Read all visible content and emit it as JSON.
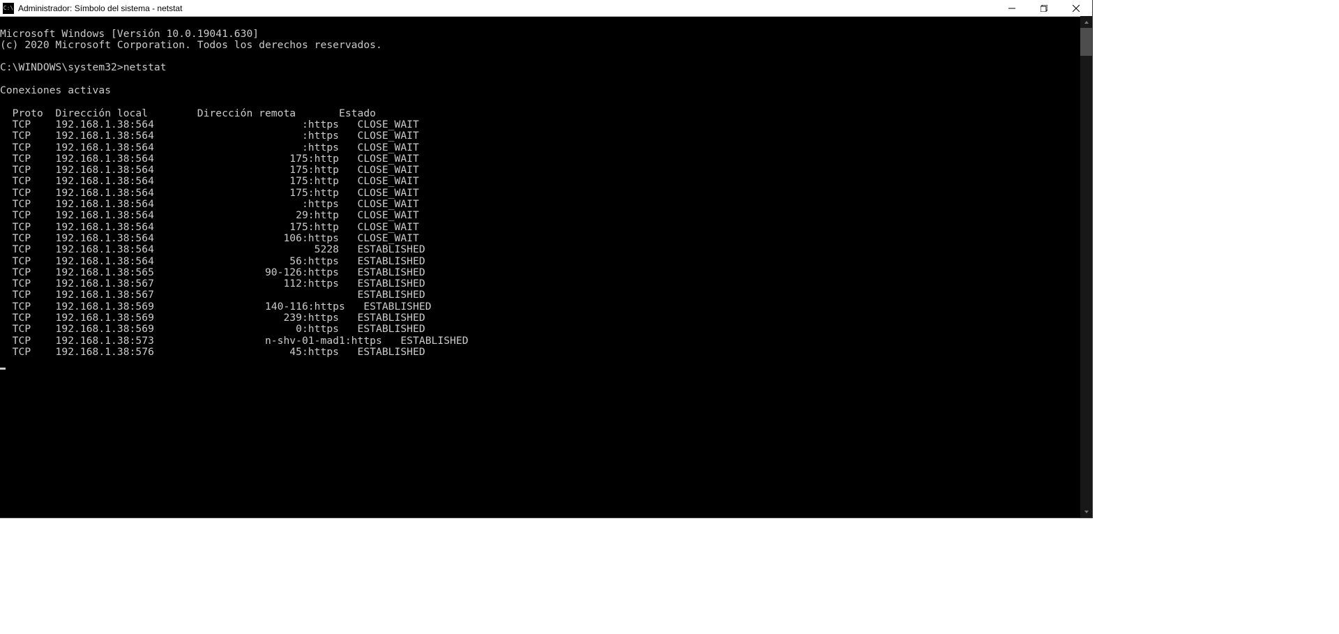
{
  "titlebar": {
    "icon_text": "C:\\",
    "title": "Administrador: Símbolo del sistema - netstat"
  },
  "terminal": {
    "line_version": "Microsoft Windows [Versión 10.0.19041.630]",
    "line_copyright": "(c) 2020 Microsoft Corporation. Todos los derechos reservados.",
    "prompt": "C:\\WINDOWS\\system32>",
    "command": "netstat",
    "section_title": "Conexiones activas",
    "headers": {
      "proto": "Proto",
      "local": "Dirección local",
      "remote": "Dirección remota",
      "state": "Estado"
    },
    "rows": [
      {
        "proto": "TCP",
        "local": "192.168.1.38:564",
        "remote": ":https",
        "state": "CLOSE_WAIT"
      },
      {
        "proto": "TCP",
        "local": "192.168.1.38:564",
        "remote": ":https",
        "state": "CLOSE_WAIT"
      },
      {
        "proto": "TCP",
        "local": "192.168.1.38:564",
        "remote": ":https",
        "state": "CLOSE_WAIT"
      },
      {
        "proto": "TCP",
        "local": "192.168.1.38:564",
        "remote": "175:http",
        "state": "CLOSE_WAIT"
      },
      {
        "proto": "TCP",
        "local": "192.168.1.38:564",
        "remote": "175:http",
        "state": "CLOSE_WAIT"
      },
      {
        "proto": "TCP",
        "local": "192.168.1.38:564",
        "remote": "175:http",
        "state": "CLOSE_WAIT"
      },
      {
        "proto": "TCP",
        "local": "192.168.1.38:564",
        "remote": "175:http",
        "state": "CLOSE_WAIT"
      },
      {
        "proto": "TCP",
        "local": "192.168.1.38:564",
        "remote": ":https",
        "state": "CLOSE_WAIT"
      },
      {
        "proto": "TCP",
        "local": "192.168.1.38:564",
        "remote": "29:http",
        "state": "CLOSE_WAIT"
      },
      {
        "proto": "TCP",
        "local": "192.168.1.38:564",
        "remote": "175:http",
        "state": "CLOSE_WAIT"
      },
      {
        "proto": "TCP",
        "local": "192.168.1.38:564",
        "remote": "106:https",
        "state": "CLOSE_WAIT"
      },
      {
        "proto": "TCP",
        "local": "192.168.1.38:564",
        "remote": "5228",
        "state": "ESTABLISHED"
      },
      {
        "proto": "TCP",
        "local": "192.168.1.38:564",
        "remote": "56:https",
        "state": "ESTABLISHED"
      },
      {
        "proto": "TCP",
        "local": "192.168.1.38:565",
        "remote": "90-126:https",
        "state": "ESTABLISHED"
      },
      {
        "proto": "TCP",
        "local": "192.168.1.38:567",
        "remote": "112:https",
        "state": "ESTABLISHED"
      },
      {
        "proto": "TCP",
        "local": "192.168.1.38:567",
        "remote": "",
        "state": "ESTABLISHED"
      },
      {
        "proto": "TCP",
        "local": "192.168.1.38:569",
        "remote": "140-116:https",
        "state": "ESTABLISHED"
      },
      {
        "proto": "TCP",
        "local": "192.168.1.38:569",
        "remote": "239:https",
        "state": "ESTABLISHED"
      },
      {
        "proto": "TCP",
        "local": "192.168.1.38:569",
        "remote": "0:https",
        "state": "ESTABLISHED"
      },
      {
        "proto": "TCP",
        "local": "192.168.1.38:573",
        "remote": "n-shv-01-mad1:https",
        "state": "ESTABLISHED"
      },
      {
        "proto": "TCP",
        "local": "192.168.1.38:576",
        "remote": "45:https",
        "state": "ESTABLISHED"
      }
    ]
  }
}
